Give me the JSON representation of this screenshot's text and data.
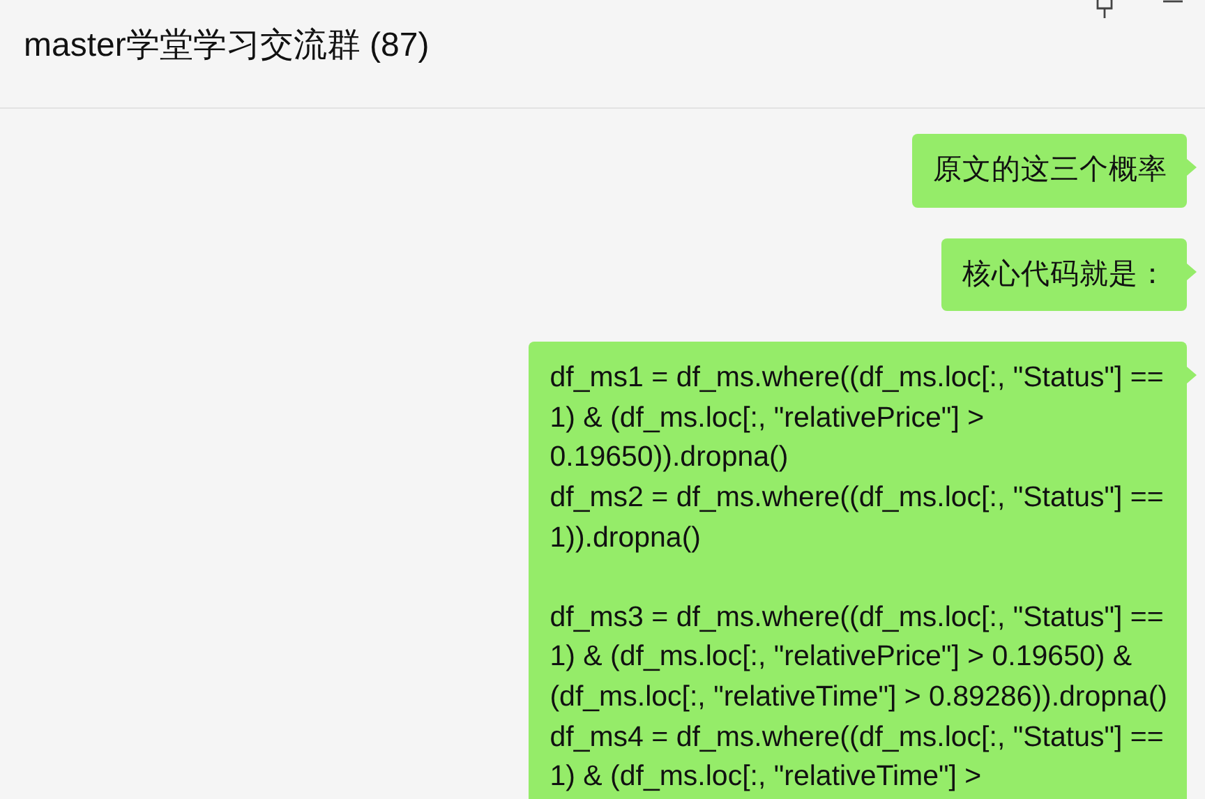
{
  "window": {
    "title": "master学堂学习交流群 (87)"
  },
  "messages": [
    {
      "paragraphs": [
        [
          "原文的这三个概率"
        ]
      ]
    },
    {
      "paragraphs": [
        [
          "核心代码就是："
        ]
      ]
    },
    {
      "paragraphs": [
        [
          "df_ms1 = df_ms.where((df_ms.loc[:, \"Status\"] ==",
          "1) & (df_ms.loc[:, \"relativePrice\"] >",
          "0.19650)).dropna()",
          "df_ms2 = df_ms.where((df_ms.loc[:, \"Status\"] ==",
          "1)).dropna()"
        ],
        [
          "df_ms3 = df_ms.where((df_ms.loc[:, \"Status\"] ==",
          "1) & (df_ms.loc[:, \"relativePrice\"] > 0.19650) &",
          "(df_ms.loc[:, \"relativeTime\"] > 0.89286)).dropna()",
          "df_ms4 = df_ms.where((df_ms.loc[:, \"Status\"] ==",
          "1) & (df_ms.loc[:, \"relativeTime\"] >"
        ]
      ]
    }
  ]
}
